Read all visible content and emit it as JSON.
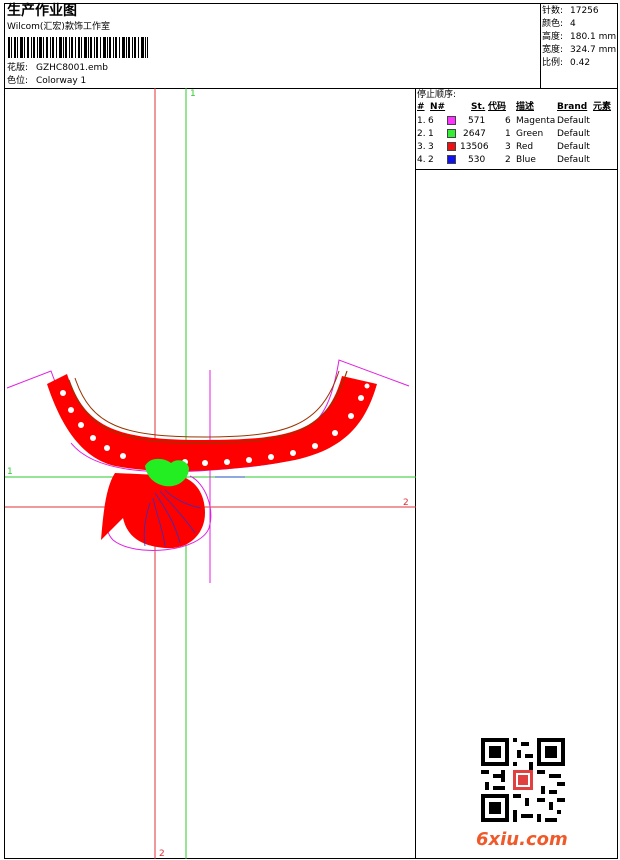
{
  "header": {
    "title": "生产作业图",
    "company": "Wilcom(汇宏)款饰工作室",
    "design_label": "花版:",
    "design_value": "GZHC8001.emb",
    "colorway_label": "色位:",
    "colorway_value": "Colorway 1"
  },
  "stats": {
    "stitches_label": "针数:",
    "stitches_value": "17256",
    "colors_label": "颜色:",
    "colors_value": "4",
    "height_label": "高度:",
    "height_value": "180.1 mm",
    "width_label": "宽度:",
    "width_value": "324.7 mm",
    "scale_label": "比例:",
    "scale_value": "0.42"
  },
  "color_table": {
    "title": "停止顺序:",
    "headers": {
      "num": "#",
      "n": "N#",
      "st": "St.",
      "code": "代码",
      "desc": "描述",
      "brand": "Brand",
      "elem": "元素"
    },
    "rows": [
      {
        "idx": "1.",
        "n": "6",
        "color": "#ff33ff",
        "st": "571",
        "code": "6",
        "desc": "Magenta",
        "brand": "Default"
      },
      {
        "idx": "2.",
        "n": "1",
        "color": "#33ee33",
        "st": "2647",
        "code": "1",
        "desc": "Green",
        "brand": "Default"
      },
      {
        "idx": "3.",
        "n": "3",
        "color": "#ee1111",
        "st": "13506",
        "code": "3",
        "desc": "Red",
        "brand": "Default"
      },
      {
        "idx": "4.",
        "n": "2",
        "color": "#1111ee",
        "st": "530",
        "code": "2",
        "desc": "Blue",
        "brand": "Default"
      }
    ]
  },
  "guides": {
    "v1_label": "1",
    "h1_label": "1",
    "h2_label": "2",
    "v2_label": "2"
  },
  "watermark": {
    "text": "6xiu.com",
    "color": "#f05a2a"
  },
  "colors": {
    "guide_red": "#e0303a",
    "guide_green": "#2ec92e",
    "outline_magenta": "#e020e0",
    "fill_red": "#ff0000",
    "fill_green": "#22ee22",
    "thread_blue": "#3030c0"
  }
}
